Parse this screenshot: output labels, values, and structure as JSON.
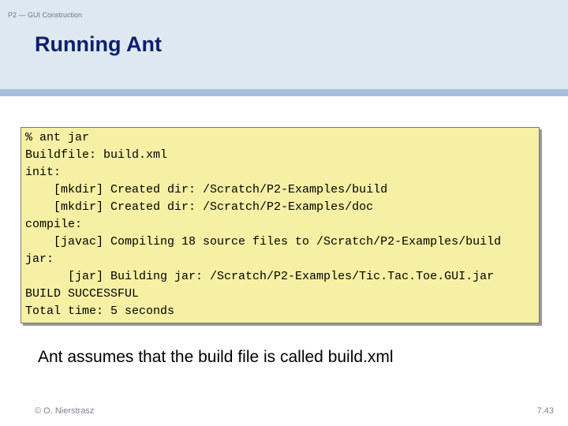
{
  "header": {
    "course": "P2 — GUI Construction",
    "title": "Running Ant"
  },
  "code": {
    "lines": [
      "% ant jar",
      "Buildfile: build.xml",
      "init:",
      "    [mkdir] Created dir: /Scratch/P2-Examples/build",
      "    [mkdir] Created dir: /Scratch/P2-Examples/doc",
      "compile:",
      "    [javac] Compiling 18 source files to /Scratch/P2-Examples/build",
      "jar:",
      "      [jar] Building jar: /Scratch/P2-Examples/Tic.Tac.Toe.GUI.jar",
      "BUILD SUCCESSFUL",
      "Total time: 5 seconds"
    ]
  },
  "caption": "Ant assumes that the build file is called build.xml",
  "footer": {
    "author": "© O. Nierstrasz",
    "page": "7.43"
  }
}
